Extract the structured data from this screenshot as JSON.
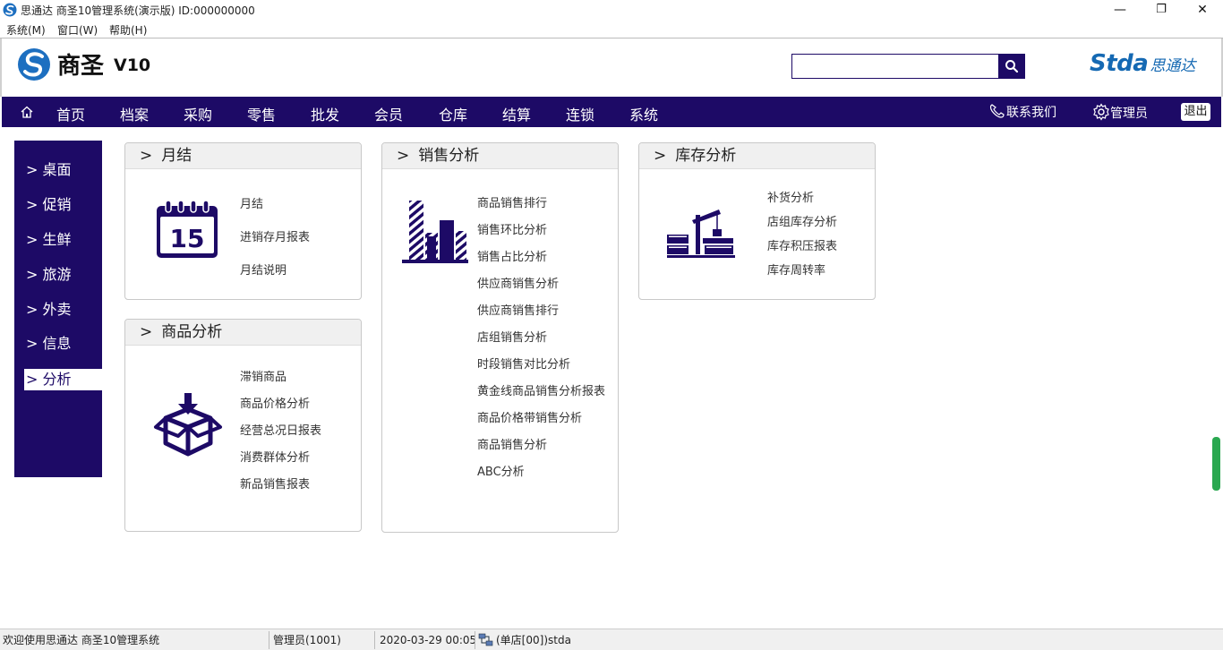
{
  "window": {
    "title": "思通达 商圣10管理系统(演示版) ID:000000000",
    "controls": {
      "minimize": "—",
      "restore": "❐",
      "close": "✕"
    }
  },
  "menubar": {
    "items": [
      "系统(M)",
      "窗口(W)",
      "帮助(H)"
    ]
  },
  "header": {
    "brand_name": "商圣",
    "brand_version": "V10",
    "search": {
      "value": "",
      "placeholder": ""
    },
    "partner_logo_en": "Stda",
    "partner_logo_cn": "思通达"
  },
  "navbar": {
    "items": [
      "首页",
      "档案",
      "采购",
      "零售",
      "批发",
      "会员",
      "仓库",
      "结算",
      "连锁",
      "系统"
    ],
    "contact": "联系我们",
    "admin": "管理员",
    "logout": "退出"
  },
  "sidebar": {
    "items": [
      {
        "label": "> 桌面",
        "active": false
      },
      {
        "label": "> 促销",
        "active": false
      },
      {
        "label": "> 生鲜",
        "active": false
      },
      {
        "label": "> 旅游",
        "active": false
      },
      {
        "label": "> 外卖",
        "active": false
      },
      {
        "label": "> 信息",
        "active": false
      },
      {
        "label": "> 分析",
        "active": true
      }
    ]
  },
  "panels": {
    "monthly": {
      "arrow": ">",
      "title": "月结",
      "icon": "calendar-icon",
      "icon_text": "15",
      "links": [
        "月结",
        "进销存月报表",
        "月结说明"
      ]
    },
    "product": {
      "arrow": ">",
      "title": "商品分析",
      "icon": "box-icon",
      "links": [
        "滞销商品",
        "商品价格分析",
        "经营总况日报表",
        "消费群体分析",
        "新品销售报表"
      ]
    },
    "sales": {
      "arrow": ">",
      "title": "销售分析",
      "icon": "buildings-icon",
      "links": [
        "商品销售排行",
        "销售环比分析",
        "销售占比分析",
        "供应商销售分析",
        "供应商销售排行",
        "店组销售分析",
        "时段销售对比分析",
        "黄金线商品销售分析报表",
        "商品价格带销售分析",
        "商品销售分析",
        "ABC分析"
      ]
    },
    "inventory": {
      "arrow": ">",
      "title": "库存分析",
      "icon": "warehouse-crane-icon",
      "links": [
        "补货分析",
        "店组库存分析",
        "库存积压报表",
        "库存周转率"
      ]
    }
  },
  "statusbar": {
    "welcome": "欢迎使用思通达 商圣10管理系统",
    "user": "管理员(1001)",
    "datetime": "2020-03-29 00:05",
    "store": "(单店[00])stda"
  },
  "colors": {
    "primary": "#1d0a66",
    "brand_blue": "#1569b3",
    "scroll_green": "#2aa850"
  }
}
